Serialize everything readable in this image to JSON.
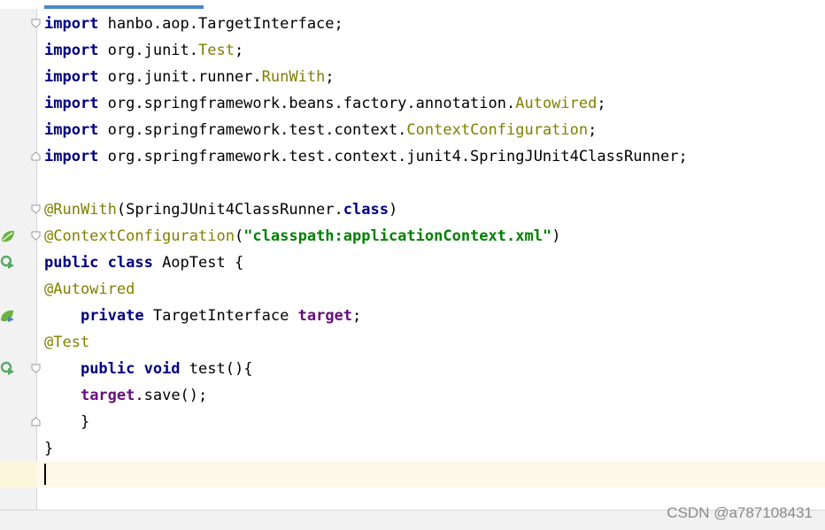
{
  "editor": {
    "lines": [
      [
        {
          "t": "import",
          "c": "kw"
        },
        {
          "t": " hanbo.aop.TargetInterface;"
        }
      ],
      [
        {
          "t": "import",
          "c": "kw"
        },
        {
          "t": " org.junit."
        },
        {
          "t": "Test",
          "c": "cls"
        },
        {
          "t": ";"
        }
      ],
      [
        {
          "t": "import",
          "c": "kw"
        },
        {
          "t": " org.junit.runner."
        },
        {
          "t": "RunWith",
          "c": "cls"
        },
        {
          "t": ";"
        }
      ],
      [
        {
          "t": "import",
          "c": "kw"
        },
        {
          "t": " org.springframework.beans.factory.annotation."
        },
        {
          "t": "Autowired",
          "c": "cls"
        },
        {
          "t": ";"
        }
      ],
      [
        {
          "t": "import",
          "c": "kw"
        },
        {
          "t": " org.springframework.test.context."
        },
        {
          "t": "ContextConfiguration",
          "c": "cls"
        },
        {
          "t": ";"
        }
      ],
      [
        {
          "t": "import",
          "c": "kw"
        },
        {
          "t": " org.springframework.test.context.junit4.SpringJUnit4ClassRunner;"
        }
      ],
      [],
      [
        {
          "t": "@RunWith",
          "c": "ann"
        },
        {
          "t": "(SpringJUnit4ClassRunner."
        },
        {
          "t": "class",
          "c": "kw"
        },
        {
          "t": ")"
        }
      ],
      [
        {
          "t": "@ContextConfiguration",
          "c": "ann"
        },
        {
          "t": "("
        },
        {
          "t": "\"classpath:applicationContext.xml\"",
          "c": "str"
        },
        {
          "t": ")"
        }
      ],
      [
        {
          "t": "public class",
          "c": "kw"
        },
        {
          "t": " AopTest {"
        }
      ],
      [
        {
          "t": "@Autowired",
          "c": "ann"
        }
      ],
      [
        {
          "t": "    "
        },
        {
          "t": "private",
          "c": "kw"
        },
        {
          "t": " TargetInterface "
        },
        {
          "t": "target",
          "c": "fld"
        },
        {
          "t": ";"
        }
      ],
      [
        {
          "t": "@Test",
          "c": "ann"
        }
      ],
      [
        {
          "t": "    "
        },
        {
          "t": "public void",
          "c": "kw"
        },
        {
          "t": " test(){"
        }
      ],
      [
        {
          "t": "    "
        },
        {
          "t": "target",
          "c": "fld"
        },
        {
          "t": ".save();"
        }
      ],
      [
        {
          "t": "    }"
        }
      ],
      [
        {
          "t": "}"
        }
      ],
      []
    ]
  },
  "gutter": {
    "icons": [
      "spring-bean-icon",
      "run-test-icon",
      "autowired-bean-icon",
      "run-test-icon"
    ],
    "fold_markers": [
      "fold-start-icon",
      "fold-end-icon",
      "fold-start-icon",
      "fold-start-icon",
      "fold-start-icon",
      "fold-end-icon"
    ]
  },
  "colors": {
    "keyword": "#000080",
    "annotation": "#808000",
    "string": "#008000",
    "field": "#660e7a",
    "caret_line": "#fdfaea",
    "gutter_bg": "#f2f2f2"
  },
  "watermark": {
    "text": "CSDN @a787108431"
  }
}
